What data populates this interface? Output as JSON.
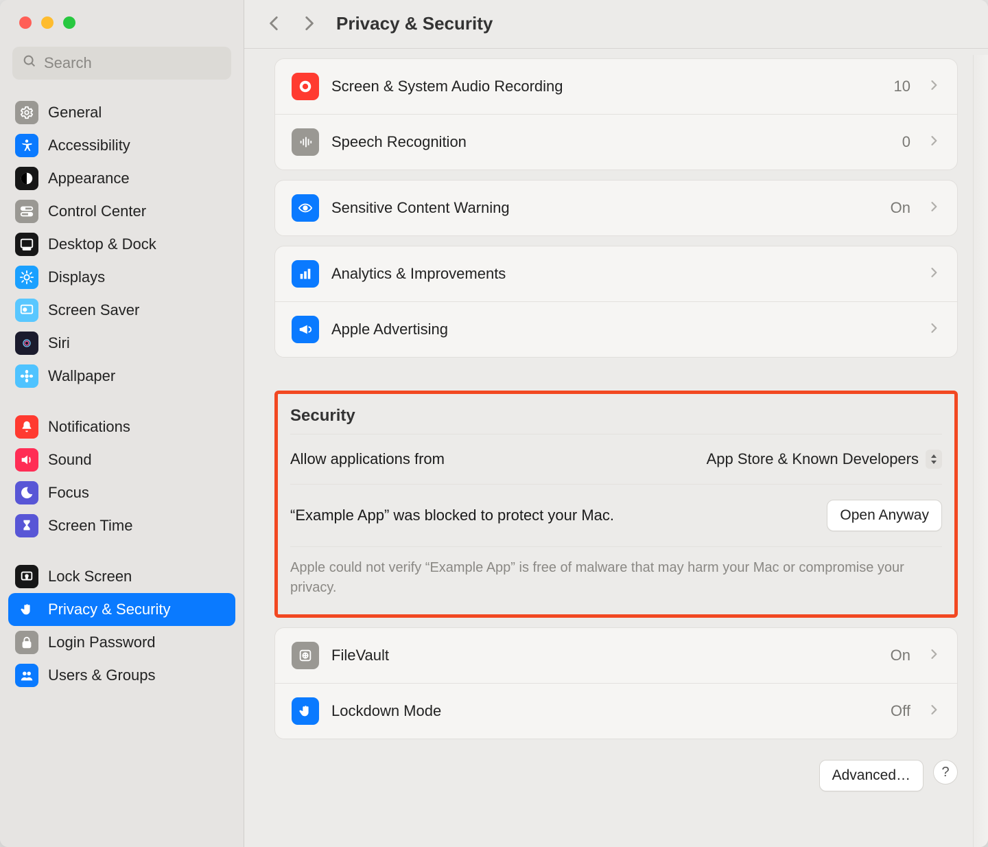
{
  "window": {
    "title": "Privacy & Security"
  },
  "search": {
    "placeholder": "Search"
  },
  "sidebar": {
    "groups": [
      [
        {
          "id": "general",
          "label": "General",
          "icon": "gear",
          "bg": "#9a9893",
          "fg": "#fff"
        },
        {
          "id": "accessibility",
          "label": "Accessibility",
          "icon": "accessibility",
          "bg": "#0a7aff",
          "fg": "#fff"
        },
        {
          "id": "appearance",
          "label": "Appearance",
          "icon": "appearance",
          "bg": "#171717",
          "fg": "#fff"
        },
        {
          "id": "control-center",
          "label": "Control Center",
          "icon": "switches",
          "bg": "#9a9893",
          "fg": "#fff"
        },
        {
          "id": "desktop-dock",
          "label": "Desktop & Dock",
          "icon": "dock",
          "bg": "#171717",
          "fg": "#fff"
        },
        {
          "id": "displays",
          "label": "Displays",
          "icon": "sun",
          "bg": "#1aa0ff",
          "fg": "#fff"
        },
        {
          "id": "screen-saver",
          "label": "Screen Saver",
          "icon": "screensaver",
          "bg": "#59c7ff",
          "fg": "#fff"
        },
        {
          "id": "siri",
          "label": "Siri",
          "icon": "siri",
          "bg": "#1b1b2d",
          "fg": "#fff"
        },
        {
          "id": "wallpaper",
          "label": "Wallpaper",
          "icon": "flower",
          "bg": "#4fc3ff",
          "fg": "#fff"
        }
      ],
      [
        {
          "id": "notifications",
          "label": "Notifications",
          "icon": "bell",
          "bg": "#ff3a30",
          "fg": "#fff"
        },
        {
          "id": "sound",
          "label": "Sound",
          "icon": "speaker",
          "bg": "#ff2d55",
          "fg": "#fff"
        },
        {
          "id": "focus",
          "label": "Focus",
          "icon": "moon",
          "bg": "#5856d6",
          "fg": "#fff"
        },
        {
          "id": "screen-time",
          "label": "Screen Time",
          "icon": "hourglass",
          "bg": "#5856d6",
          "fg": "#fff"
        }
      ],
      [
        {
          "id": "lock-screen",
          "label": "Lock Screen",
          "icon": "lock",
          "bg": "#171717",
          "fg": "#fff"
        },
        {
          "id": "privacy-security",
          "label": "Privacy & Security",
          "icon": "hand",
          "bg": "#0a7aff",
          "fg": "#fff",
          "selected": true
        },
        {
          "id": "login-password",
          "label": "Login Password",
          "icon": "padlock",
          "bg": "#9a9893",
          "fg": "#fff"
        },
        {
          "id": "users-groups",
          "label": "Users & Groups",
          "icon": "users",
          "bg": "#0a7aff",
          "fg": "#fff"
        }
      ]
    ]
  },
  "main": {
    "sections": [
      {
        "rows": [
          {
            "id": "screen-audio",
            "label": "Screen & System Audio Recording",
            "value": "10",
            "icon": "record",
            "bg": "#ff3b30"
          },
          {
            "id": "speech",
            "label": "Speech Recognition",
            "value": "0",
            "icon": "waveform",
            "bg": "#9a9893"
          }
        ]
      },
      {
        "rows": [
          {
            "id": "sensitive",
            "label": "Sensitive Content Warning",
            "value": "On",
            "icon": "eye",
            "bg": "#0a7aff"
          }
        ]
      },
      {
        "rows": [
          {
            "id": "analytics",
            "label": "Analytics & Improvements",
            "value": "",
            "icon": "bars",
            "bg": "#0a7aff"
          },
          {
            "id": "advertising",
            "label": "Apple Advertising",
            "value": "",
            "icon": "megaphone",
            "bg": "#0a7aff"
          }
        ]
      }
    ],
    "security": {
      "heading": "Security",
      "allow_label": "Allow applications from",
      "allow_value": "App Store & Known Developers",
      "blocked_text": "“Example App” was blocked to protect your Mac.",
      "open_anyway": "Open Anyway",
      "note": "Apple could not verify “Example App” is free of malware that may harm your Mac or compromise your privacy."
    },
    "sections2": [
      {
        "rows": [
          {
            "id": "filevault",
            "label": "FileVault",
            "value": "On",
            "icon": "vault",
            "bg": "#9a9893"
          },
          {
            "id": "lockdown",
            "label": "Lockdown Mode",
            "value": "Off",
            "icon": "hand",
            "bg": "#0a7aff"
          }
        ]
      }
    ],
    "footer": {
      "advanced": "Advanced…",
      "help": "?"
    }
  }
}
